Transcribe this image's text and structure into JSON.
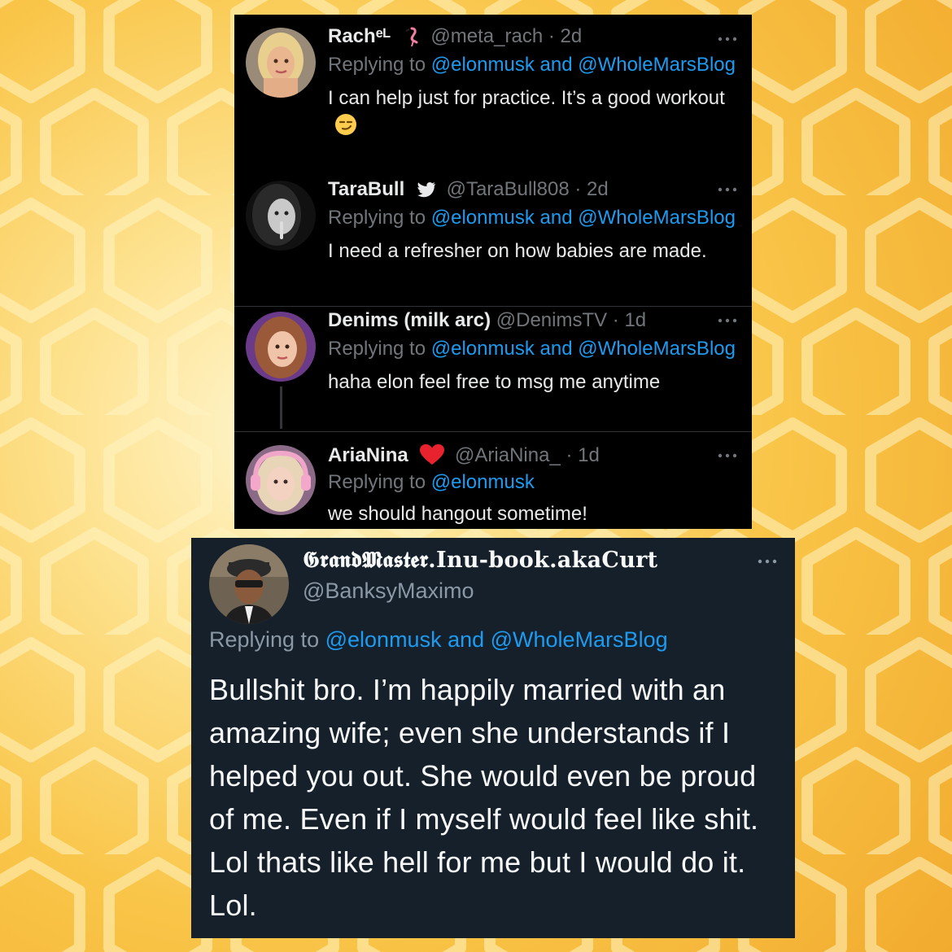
{
  "colors": {
    "background": "#f9c548",
    "top_panel_bg": "#000000",
    "bottom_panel_bg": "#15202b",
    "mention_blue": "#1d9bf0",
    "muted_gray": "#71767b"
  },
  "top_panel": {
    "tweets": [
      {
        "display_name": "Rachᵉᴸ",
        "name_emoji": "flamingo-icon",
        "meta": "@meta_rach · 2d",
        "replying_prefix": "Replying to",
        "replying_mentions": "@elonmusk and @WholeMarsBlog",
        "text": "I can help just for practice. It’s a good workout",
        "text_emoji": "smirking-face-icon"
      },
      {
        "display_name": "TaraBull",
        "name_emoji": "twitter-bird-icon",
        "meta": "@TaraBull808 · 2d",
        "replying_prefix": "Replying to",
        "replying_mentions": "@elonmusk and @WholeMarsBlog",
        "text": "I need a refresher on how babies are made."
      },
      {
        "display_name": "Denims (milk arc)",
        "meta": "@DenimsTV · 1d",
        "replying_prefix": "Replying to",
        "replying_mentions": "@elonmusk and @WholeMarsBlog",
        "text": "haha elon feel free to msg me anytime"
      },
      {
        "display_name": "AriaNina",
        "name_emoji": "red-heart-icon",
        "meta": "@AriaNina_ · 1d",
        "replying_prefix": "Replying to",
        "replying_mentions": "@elonmusk",
        "text": "we should hangout sometime!"
      }
    ]
  },
  "bottom_panel": {
    "display_name": "𝕲𝖗𝖆𝖓𝖉𝕸𝖆𝖘𝖙𝖊𝖗.Inu-book.akaCurt",
    "handle": "@BanksyMaximo",
    "replying_prefix": "Replying to",
    "replying_mentions": "@elonmusk and @WholeMarsBlog",
    "text": "Bullshit bro. I’m happily married with an amazing wife; even she understands if I helped you out. She would even be proud of me. Even if I myself would feel like shit. Lol thats like hell for me but I would do it. Lol."
  }
}
